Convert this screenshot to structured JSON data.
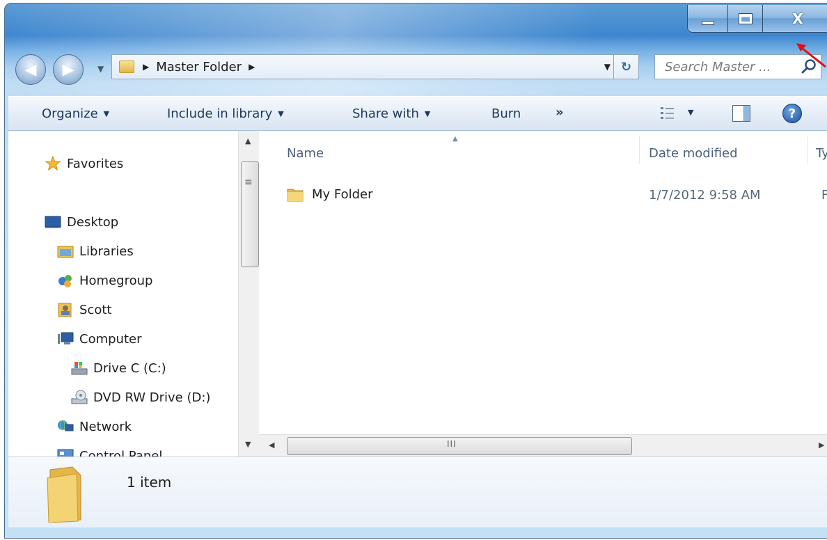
{
  "window": {
    "caption_close": "X"
  },
  "address_bar": {
    "path": "Master Folder"
  },
  "search": {
    "placeholder": "Search Master ..."
  },
  "command_bar": {
    "organize": "Organize",
    "include_in_library": "Include in library",
    "share_with": "Share with",
    "burn": "Burn",
    "more": "»"
  },
  "nav_pane": {
    "items": [
      {
        "label": "Favorites",
        "icon": "star-icon"
      },
      {
        "label": "Desktop",
        "icon": "desktop-icon"
      },
      {
        "label": "Libraries",
        "icon": "libraries-icon"
      },
      {
        "label": "Homegroup",
        "icon": "homegroup-icon"
      },
      {
        "label": "Scott",
        "icon": "user-folder-icon"
      },
      {
        "label": "Computer",
        "icon": "computer-icon"
      },
      {
        "label": "Drive C (C:)",
        "icon": "hard-drive-icon"
      },
      {
        "label": "DVD RW Drive (D:)",
        "icon": "dvd-drive-icon"
      },
      {
        "label": "Network",
        "icon": "network-icon"
      },
      {
        "label": "Control Panel",
        "icon": "control-panel-icon"
      }
    ]
  },
  "file_list": {
    "columns": [
      "Name",
      "Date modified",
      "Ty"
    ],
    "rows": [
      {
        "name": "My Folder",
        "date_modified": "1/7/2012 9:58 AM",
        "type": "Fi"
      }
    ]
  },
  "details_pane": {
    "item_count": "1 item"
  },
  "colors": {
    "frame": "#bfdcf4",
    "command_text": "#1e395b",
    "annotation_arrow": "#e01010"
  }
}
